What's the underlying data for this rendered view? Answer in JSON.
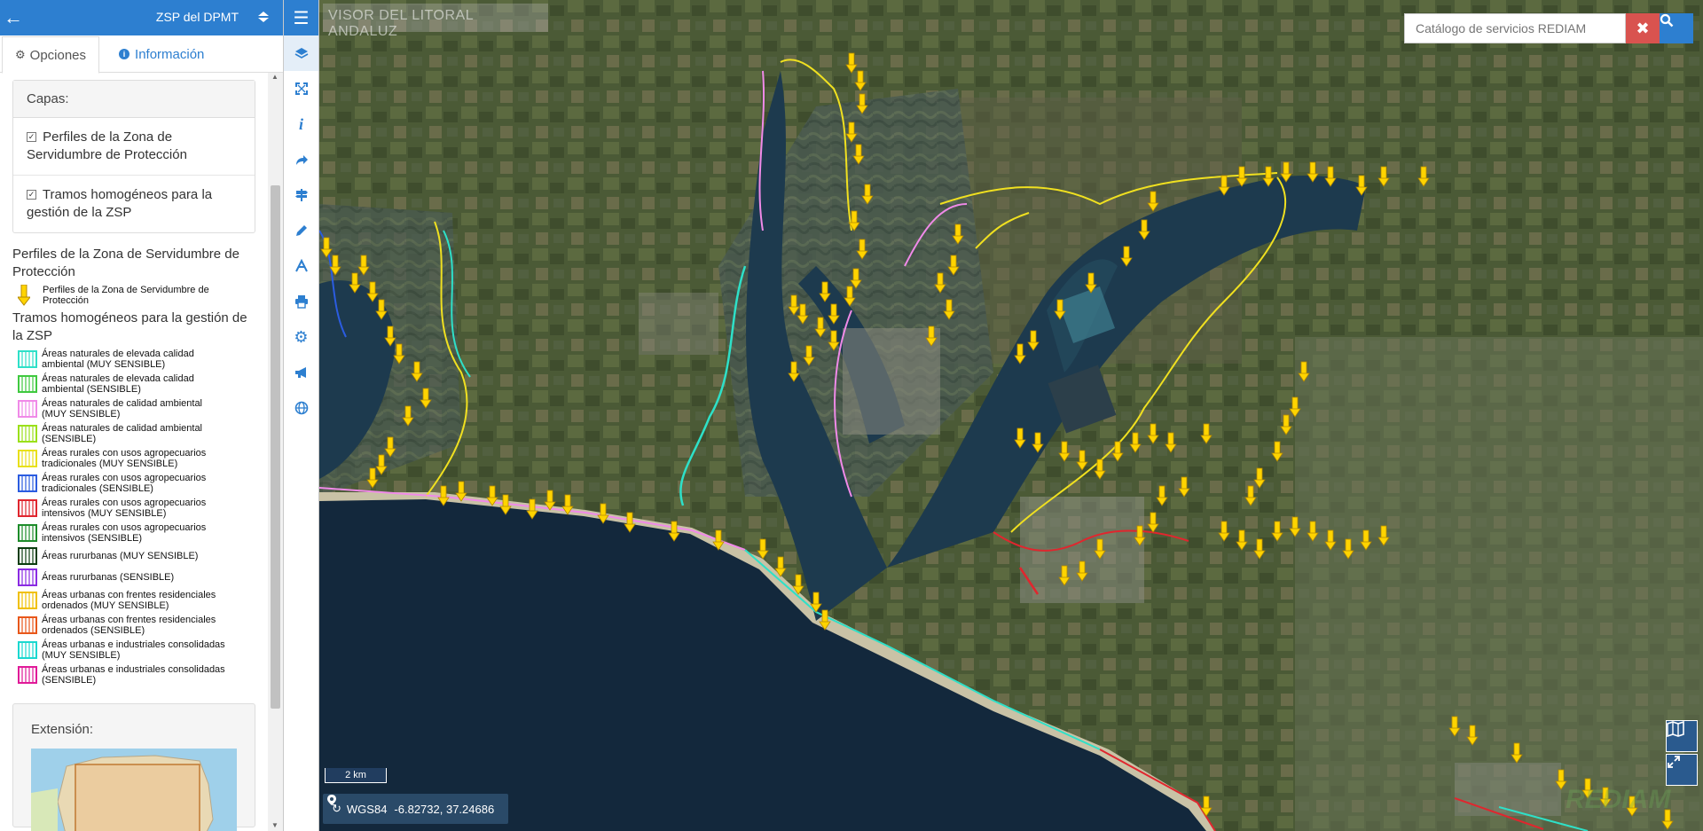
{
  "panel": {
    "title": "ZSP del DPMT",
    "tabs": [
      {
        "label": "Opciones",
        "active": true
      },
      {
        "label": "Información",
        "active": false
      }
    ],
    "layers_header": "Capas:",
    "layers": [
      {
        "label": "Perfiles de la Zona de Servidumbre de Protección",
        "checked": true
      },
      {
        "label": "Tramos homogéneos para la gestión de la ZSP",
        "checked": true
      }
    ],
    "legend": {
      "profiles_title": "Perfiles de la Zona de Servidumbre de Protección",
      "profiles_item": "Perfiles de la Zona de Servidumbre de Protección",
      "stretches_title": "Tramos homogéneos para la gestión de la ZSP",
      "items": [
        {
          "label": "Áreas naturales de elevada calidad ambiental (MUY SENSIBLE)",
          "color": "#2ee0c8"
        },
        {
          "label": "Áreas naturales de elevada calidad ambiental (SENSIBLE)",
          "color": "#3fc93f"
        },
        {
          "label": "Áreas naturales de calidad ambiental (MUY SENSIBLE)",
          "color": "#f08ae8"
        },
        {
          "label": "Áreas naturales de calidad ambiental (SENSIBLE)",
          "color": "#9be01a"
        },
        {
          "label": "Áreas rurales con usos agropecuarios tradicionales (MUY SENSIBLE)",
          "color": "#e8e01a"
        },
        {
          "label": "Áreas rurales con usos agropecuarios tradicionales (SENSIBLE)",
          "color": "#2b5ce0"
        },
        {
          "label": "Áreas rurales con usos agropecuarios intensivos (MUY SENSIBLE)",
          "color": "#e0262e"
        },
        {
          "label": "Áreas rurales con usos agropecuarios intensivos (SENSIBLE)",
          "color": "#1d8c2a"
        },
        {
          "label": "Áreas rururbanas (MUY SENSIBLE)",
          "color": "#0b3d0f"
        },
        {
          "label": "Áreas rururbanas (SENSIBLE)",
          "color": "#8a2be2"
        },
        {
          "label": "Áreas urbanas con frentes residenciales ordenados (MUY SENSIBLE)",
          "color": "#f0c000"
        },
        {
          "label": "Áreas urbanas con frentes residenciales ordenados (SENSIBLE)",
          "color": "#e8571a"
        },
        {
          "label": "Áreas urbanas e industriales consolidadas (MUY SENSIBLE)",
          "color": "#1ad8d0"
        },
        {
          "label": "Áreas urbanas e industriales consolidadas (SENSIBLE)",
          "color": "#e01a98"
        }
      ]
    },
    "extent_title": "Extensión:"
  },
  "toolbar": {
    "tools": [
      {
        "name": "layers-icon"
      },
      {
        "name": "fullscreen-icon"
      },
      {
        "name": "info-icon"
      },
      {
        "name": "share-icon"
      },
      {
        "name": "signpost-icon"
      },
      {
        "name": "pencil-icon"
      },
      {
        "name": "route-icon"
      },
      {
        "name": "print-icon"
      },
      {
        "name": "gear-icon"
      },
      {
        "name": "megaphone-icon"
      },
      {
        "name": "globe-icon"
      }
    ]
  },
  "map": {
    "viewer_title": "VISOR DEL LITORAL ANDALUZ",
    "search_placeholder": "Catálogo de servicios REDIAM",
    "scale_label": "2 km",
    "crs": "WGS84",
    "coords": "-6.82732, 37.24686",
    "watermark": "REDIAM",
    "colors": {
      "accent": "#2d7fd0",
      "danger": "#d9534f",
      "arrow": "#ffd400"
    }
  }
}
